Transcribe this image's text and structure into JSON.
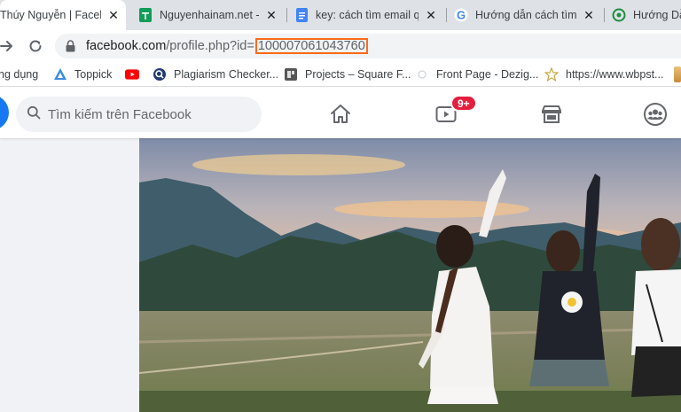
{
  "tabs": [
    {
      "title": "Thúy Nguyễn | Facebo",
      "active": true
    },
    {
      "title": "Nguyenhainam.net - C"
    },
    {
      "title": "key: cách tìm email qu"
    },
    {
      "title": "Hướng dẫn cách tìm e"
    },
    {
      "title": "Hướng Dẫ"
    }
  ],
  "address": {
    "host": "facebook.com",
    "path": "/profile.php?id=",
    "id": "100007061043760"
  },
  "bookmarks": [
    {
      "label": "ng dụng",
      "icon": "apps-grid-icon"
    },
    {
      "label": "Toppick",
      "icon": "toppick-icon"
    },
    {
      "label": "",
      "icon": "youtube-icon"
    },
    {
      "label": "Plagiarism Checker...",
      "icon": "plagiarism-checker-icon"
    },
    {
      "label": "Projects – Square F...",
      "icon": "square-projects-icon"
    },
    {
      "label": "Front Page - Dezig...",
      "icon": "dezign-icon"
    },
    {
      "label": "https://www.wbpst...",
      "icon": "wbp-icon"
    }
  ],
  "facebook": {
    "search_placeholder": "Tìm kiếm trên Facebook",
    "watch_badge": "9+"
  },
  "colors": {
    "facebook_blue": "#1877f2",
    "badge_red": "#e41e3f",
    "highlight_orange": "#ff6a1a"
  }
}
